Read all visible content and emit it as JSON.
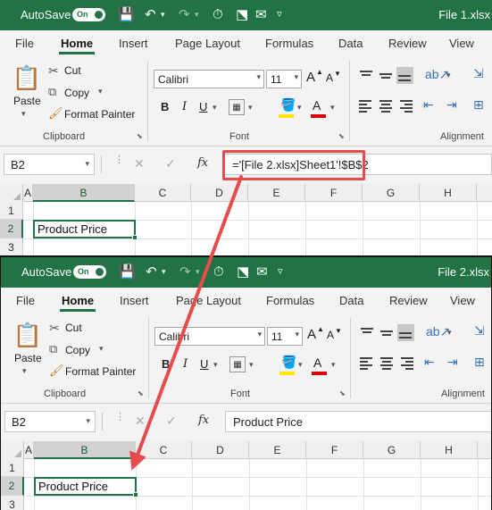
{
  "windows": [
    {
      "autosave_label": "AutoSave",
      "autosave_state": "On",
      "filename": "File 1.xlsx",
      "name_box": "B2",
      "formula": "='[File 2.xlsx]Sheet1'!$B$2",
      "cell_b2": "Product Price"
    },
    {
      "autosave_label": "AutoSave",
      "autosave_state": "On",
      "filename": "File 2.xlsx",
      "name_box": "B2",
      "formula": "Product Price",
      "cell_b2": "Product Price"
    }
  ],
  "menu": [
    "File",
    "Home",
    "Insert",
    "Page Layout",
    "Formulas",
    "Data",
    "Review",
    "View"
  ],
  "ribbon": {
    "clipboard_label": "Clipboard",
    "font_label": "Font",
    "alignment_label": "Alignment",
    "paste": "Paste",
    "cut": "Cut",
    "copy": "Copy",
    "format_painter": "Format Painter",
    "font_name": "Calibri",
    "font_size": "11",
    "bold": "B",
    "italic": "I",
    "underline": "U",
    "grow_font": "A",
    "shrink_font": "A"
  },
  "grid": {
    "columns": [
      "A",
      "B",
      "C",
      "D",
      "E",
      "F",
      "G",
      "H"
    ],
    "rows": [
      "1",
      "2",
      "3"
    ]
  },
  "colors": {
    "excel_green": "#217346",
    "annotation_red": "#e64c4c"
  }
}
